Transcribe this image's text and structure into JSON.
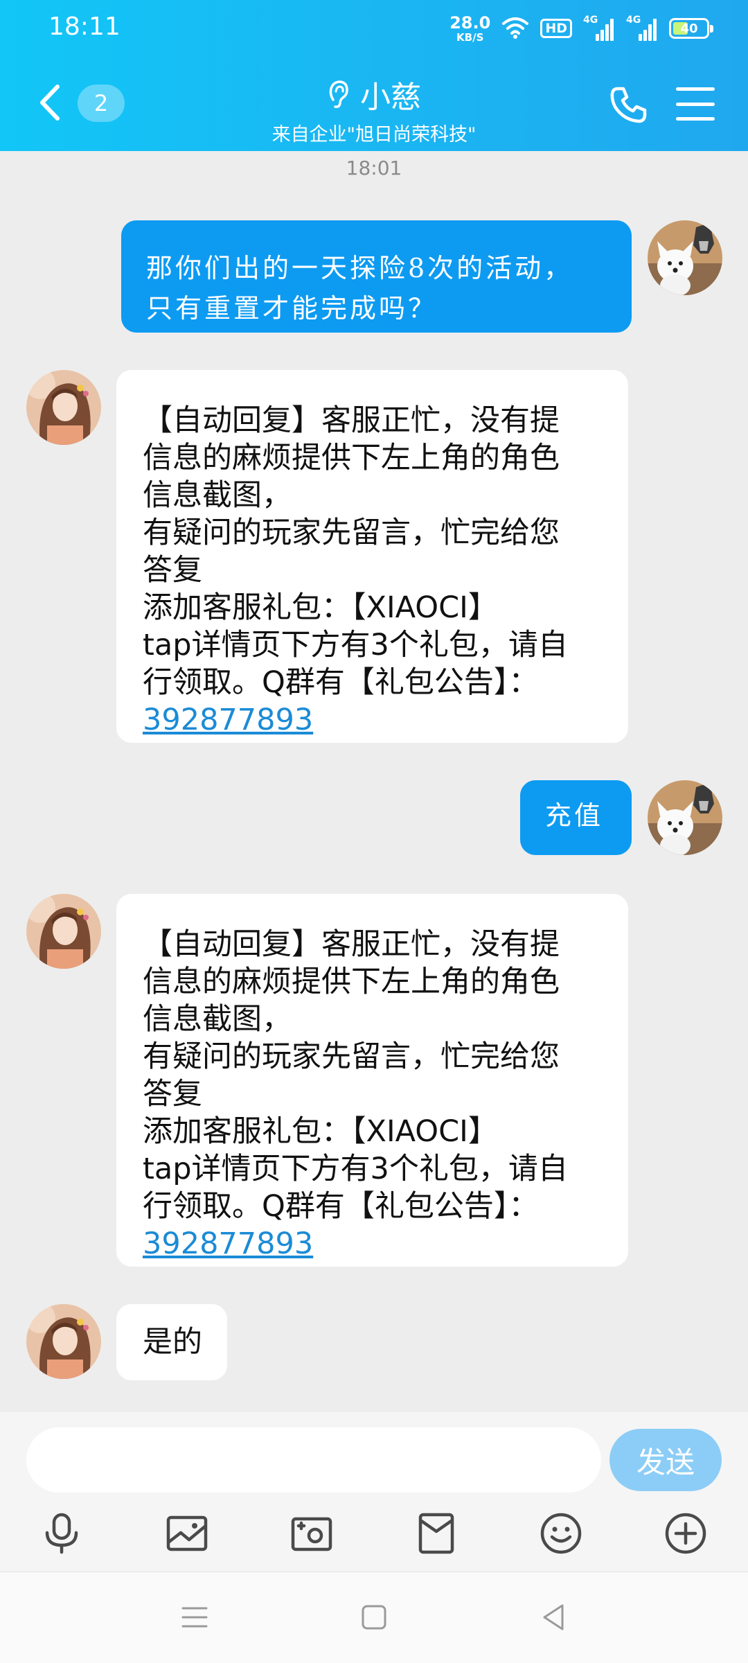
{
  "status_bar": {
    "time": "18:11",
    "net_speed_value": "28.0",
    "net_speed_unit": "KB/S",
    "hd_label": "HD",
    "signal1_label": "4G",
    "signal2_label": "4G",
    "battery_level": "40"
  },
  "header": {
    "unread_count": "2",
    "title": "小慈",
    "subtitle": "来自企业\"旭日尚荣科技\"",
    "accent_color": "#19b8f3"
  },
  "chat": {
    "timestamp": "18:01",
    "messages": [
      {
        "direction": "out",
        "avatar": "dog-avatar",
        "lines": [
          "那你们出的一天探险8次的活动，",
          "只有重置才能完成吗？"
        ]
      },
      {
        "direction": "in",
        "avatar": "girl-avatar",
        "lines": [
          "【自动回复】客服正忙，没有提",
          "信息的麻烦提供下左上角的角色",
          "信息截图，",
          "有疑问的玩家先留言，忙完给您",
          "答复",
          "添加客服礼包：【XIAOCI】",
          "tap详情页下方有3个礼包，请自",
          "行领取。Q群有【礼包公告】："
        ],
        "link": "392877893"
      },
      {
        "direction": "out",
        "avatar": "dog-avatar",
        "lines": [
          "充值"
        ]
      },
      {
        "direction": "in",
        "avatar": "girl-avatar",
        "lines": [
          "【自动回复】客服正忙，没有提",
          "信息的麻烦提供下左上角的角色",
          "信息截图，",
          "有疑问的玩家先留言，忙完给您",
          "答复",
          "添加客服礼包：【XIAOCI】",
          "tap详情页下方有3个礼包，请自",
          "行领取。Q群有【礼包公告】："
        ],
        "link": "392877893"
      },
      {
        "direction": "in",
        "avatar": "girl-avatar",
        "lines": [
          "是的"
        ]
      }
    ]
  },
  "input": {
    "value": "",
    "send_label": "发送"
  },
  "toolbar_icons": [
    "microphone-icon",
    "image-icon",
    "camera-icon",
    "red-packet-icon",
    "emoji-icon",
    "plus-icon"
  ],
  "nav_icons": [
    "menu-icon",
    "home-icon",
    "back-icon"
  ]
}
